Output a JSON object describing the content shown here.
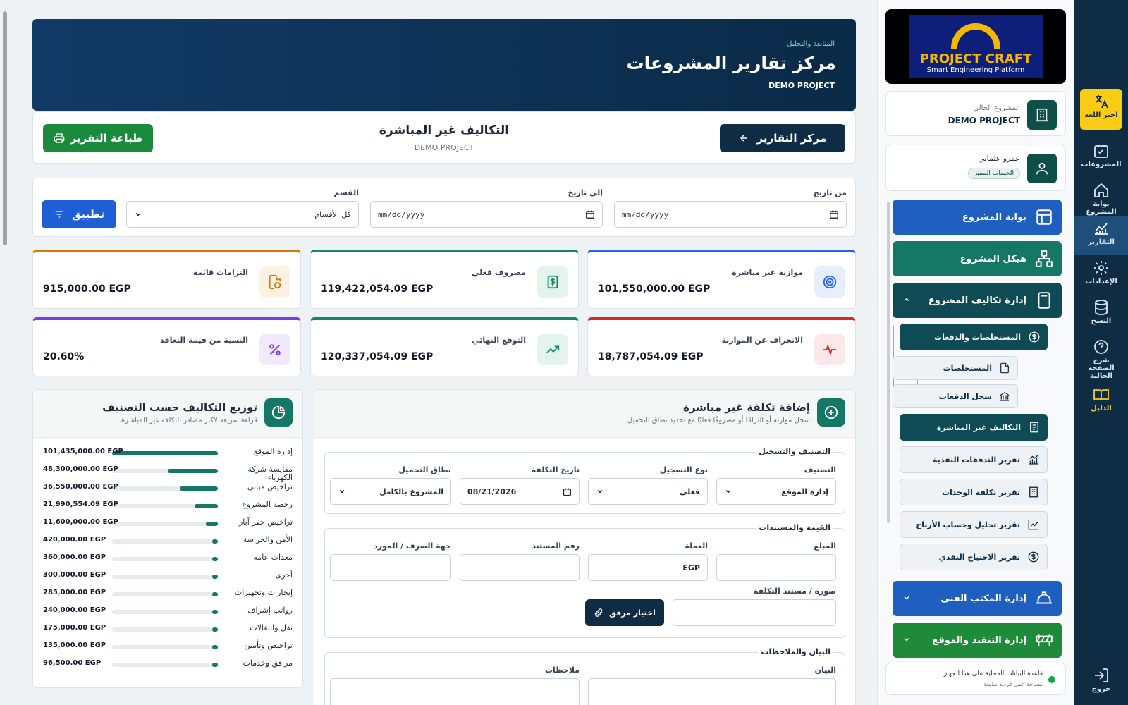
{
  "rail": {
    "lang": "اختر اللغة",
    "projects": "المشروعات",
    "portal": "بوابة المشروع",
    "reports": "التقارير",
    "settings": "الإعدادات",
    "backup": "النسخ",
    "explain": "شرح الصفحة الحالية",
    "guide": "الدليل",
    "logout": "خروج"
  },
  "sidebar": {
    "logo_title": "PROJECT CRAFT",
    "logo_sub": "Smart Engineering Platform",
    "current_project_label": "المشروع الحالي",
    "current_project": "DEMO PROJECT",
    "user_name": "عمرو عثماني",
    "user_badge": "الحساب المميز",
    "nav": {
      "portal": "بوابة المشروع",
      "structure": "هيكل المشروع",
      "costs": "إدارة تكاليف المشروع",
      "technical": "إدارة المكتب الفني",
      "execution": "إدارة التنفيذ والموقع"
    },
    "sub": {
      "payments": "المستخلصات والدفعات",
      "claims": "المستخلصات",
      "payment_log": "سجل الدفعات",
      "indirect": "التكاليف غير المباشرة",
      "cashflow": "تقرير التدفقات النقدية",
      "unit_cost": "تقرير تكلفة الوحدات",
      "profit": "تقرير تحليل وحساب الأرباح",
      "cash_need": "تقرير الاحتياج النقدي"
    },
    "db_status": "قاعدة البيانات المحلية على هذا الجهاز",
    "db_sub": "مساحة عمل فردية مؤمنة"
  },
  "hero": {
    "eyebrow": "المتابعة والتحليل",
    "title": "مركز تقارير المشروعات",
    "project": "DEMO PROJECT"
  },
  "toolbar": {
    "reports_btn": "مركز التقارير",
    "title": "التكاليف غير المباشرة",
    "subtitle": "DEMO PROJECT",
    "print_btn": "طباعة التقرير"
  },
  "filters": {
    "from_label": "من تاريخ",
    "from_value": "mm/dd/yyyy",
    "to_label": "إلى تاريخ",
    "to_value": "mm/dd/yyyy",
    "dept_label": "القسم",
    "dept_value": "كل الأقسام",
    "apply_btn": "تطبيق"
  },
  "kpis": [
    {
      "label": "موازنة غير مباشرة",
      "value": "101,550,000.00 EGP",
      "color": "#2563eb"
    },
    {
      "label": "مصروف فعلي",
      "value": "119,422,054.09 EGP",
      "color": "#0f8a62"
    },
    {
      "label": "التزامات قائمة",
      "value": "915,000.00 EGP",
      "color": "#d97706"
    },
    {
      "label": "الانحراف عن الموازنة",
      "value": "18,787,054.09 EGP",
      "color": "#dc2626"
    },
    {
      "label": "التوقع النهائي",
      "value": "120,337,054.09 EGP",
      "color": "#0f8a62"
    },
    {
      "label": "النسبة من قيمة التعاقد",
      "value": "20.60%",
      "color": "#7c3aed"
    }
  ],
  "distribution": {
    "title": "توزيع التكاليف حسب التصنيف",
    "subtitle": "قراءة سريعة لأكبر مصادر التكلفة غير المباشرة.",
    "rows": [
      {
        "label": "إدارة الموقع",
        "value": "101,435,000.00 EGP",
        "amount": 101435000
      },
      {
        "label": "مقايسة شركة الكهرباء",
        "value": "48,300,000.00 EGP",
        "amount": 48300000
      },
      {
        "label": "تراخيص مباني",
        "value": "36,550,000.00 EGP",
        "amount": 36550000
      },
      {
        "label": "رخصة المشروع",
        "value": "21,990,554.09 EGP",
        "amount": 21990554.09
      },
      {
        "label": "تراخيص حفر آبار",
        "value": "11,600,000.00 EGP",
        "amount": 11600000
      },
      {
        "label": "الأمن والحراسة",
        "value": "420,000.00 EGP",
        "amount": 420000
      },
      {
        "label": "معدات عامة",
        "value": "360,000.00 EGP",
        "amount": 360000
      },
      {
        "label": "أخرى",
        "value": "300,000.00 EGP",
        "amount": 300000
      },
      {
        "label": "إيجارات وتجهيزات",
        "value": "285,000.00 EGP",
        "amount": 285000
      },
      {
        "label": "رواتب إشراف",
        "value": "240,000.00 EGP",
        "amount": 240000
      },
      {
        "label": "نقل وانتقالات",
        "value": "175,000.00 EGP",
        "amount": 175000
      },
      {
        "label": "تراخيص وتأمين",
        "value": "135,000.00 EGP",
        "amount": 135000
      },
      {
        "label": "مرافق وخدمات",
        "value": "96,500.00 EGP",
        "amount": 96500
      }
    ]
  },
  "form": {
    "title": "إضافة تكلفة غير مباشرة",
    "subtitle": "سجل موازنة أو التزامًا أو مصروفًا فعليًا مع تحديد نطاق التحميل.",
    "section1": "التصنيف والتسجيل",
    "category_label": "التصنيف",
    "category_value": "إدارة الموقع",
    "entry_type_label": "نوع التسجيل",
    "entry_type_value": "فعلي",
    "cost_date_label": "تاريخ التكلفة",
    "cost_date_value": "08/21/2026",
    "scope_label": "نطاق التحميل",
    "scope_value": "المشروع بالكامل",
    "section2": "القيمة والمستندات",
    "amount_label": "المبلغ",
    "amount_value": "",
    "currency_label": "العملة",
    "currency_value": "EGP",
    "doc_no_label": "رقم المستند",
    "doc_no_value": "",
    "vendor_label": "جهة الصرف / المورد",
    "vendor_value": "",
    "attachment_label": "صورة / مستند التكلفة",
    "attach_btn": "اختيار مرفق",
    "section3": "البيان والملاحظات",
    "desc_label": "البيان",
    "notes_label": "ملاحظات"
  }
}
